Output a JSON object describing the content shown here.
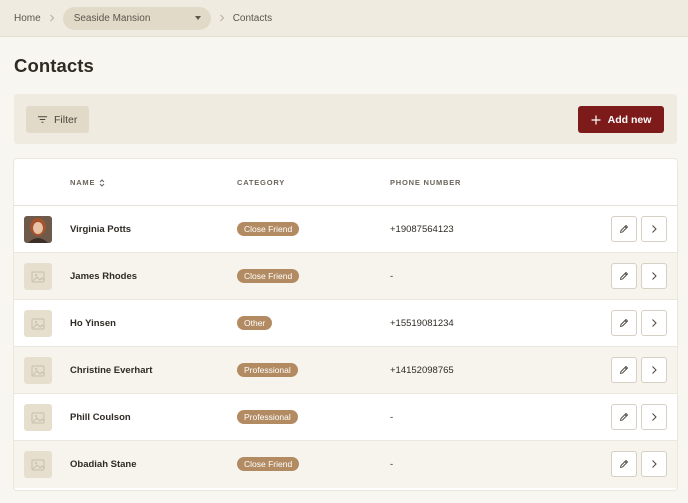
{
  "breadcrumb": {
    "home": "Home",
    "property": "Seaside Mansion",
    "current": "Contacts"
  },
  "page": {
    "title": "Contacts"
  },
  "toolbar": {
    "filter_label": "Filter",
    "add_label": "Add new"
  },
  "table": {
    "columns": {
      "name": "NAME",
      "category": "CATEGORY",
      "phone": "PHONE NUMBER"
    },
    "rows": [
      {
        "name": "Virginia Potts",
        "category": "Close Friend",
        "phone": "+19087564123",
        "has_photo": true
      },
      {
        "name": "James Rhodes",
        "category": "Close Friend",
        "phone": "-",
        "has_photo": false
      },
      {
        "name": "Ho Yinsen",
        "category": "Other",
        "phone": "+15519081234",
        "has_photo": false
      },
      {
        "name": "Christine Everhart",
        "category": "Professional",
        "phone": "+14152098765",
        "has_photo": false
      },
      {
        "name": "Phill Coulson",
        "category": "Professional",
        "phone": "-",
        "has_photo": false
      },
      {
        "name": "Obadiah Stane",
        "category": "Close Friend",
        "phone": "-",
        "has_photo": false
      }
    ]
  },
  "icons": {
    "breadcrumb_separator": "chevron-right-icon",
    "select_caret": "caret-down-icon",
    "filter": "filter-icon",
    "add": "plus-icon",
    "sort": "sort-icon",
    "edit": "pencil-icon",
    "open": "chevron-right-icon",
    "avatar_placeholder": "image-placeholder-icon"
  },
  "colors": {
    "primary": "#7d1b1b",
    "badge": "#b28b63",
    "background": "#f8f6f1",
    "panel": "#efebe1"
  }
}
